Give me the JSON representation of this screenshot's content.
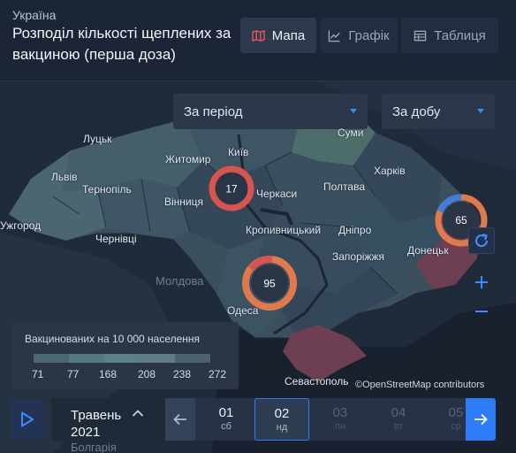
{
  "header": {
    "region": "Україна",
    "title": "Розподіл кількості щеплених за вакциною (перша доза)",
    "tabs": [
      {
        "label": "Мапа",
        "icon": "map-icon",
        "active": true
      },
      {
        "label": "Графік",
        "icon": "line-chart-icon",
        "active": false
      },
      {
        "label": "Таблиця",
        "icon": "table-icon",
        "active": false
      }
    ]
  },
  "filters": {
    "period": "За період",
    "granularity": "За добу"
  },
  "map": {
    "cities": [
      "Луцьк",
      "Житомир",
      "Київ",
      "Суми",
      "Львів",
      "Тернопіль",
      "Вінниця",
      "Черкаси",
      "Полтава",
      "Харків",
      "Ужгород",
      "Чернівці",
      "Кропивницький",
      "Дніпро",
      "Донецьк",
      "Запоріжжя",
      "Одеса",
      "Севастополь"
    ],
    "background_labels": [
      "Молдова",
      "Болгарія"
    ],
    "clusters": [
      {
        "value": "17",
        "city": "Київ"
      },
      {
        "value": "65",
        "city": "Донецьк"
      },
      {
        "value": "95",
        "city": "Одеса"
      }
    ],
    "colors": {
      "accent": "#3d8bff",
      "cluster_red": "#d9534f",
      "cluster_orange": "#e07a4a",
      "occupied": "#6e3f52"
    }
  },
  "legend": {
    "title": "Вакцинованих на 10 000 населення",
    "ticks": [
      "71",
      "77",
      "168",
      "208",
      "238",
      "272"
    ],
    "colors": [
      "#4a6872",
      "#567883",
      "#5c7f8a",
      "#5e7c86",
      "#4a6270",
      "#3f5263"
    ]
  },
  "attribution": "©OpenStreetMap contributors",
  "timeline": {
    "month": "Травень",
    "year": "2021",
    "days": [
      {
        "num": "01",
        "dow": "сб",
        "state": "enabled"
      },
      {
        "num": "02",
        "dow": "нд",
        "state": "active"
      },
      {
        "num": "03",
        "dow": "пн",
        "state": "disabled"
      },
      {
        "num": "04",
        "dow": "вт",
        "state": "disabled"
      },
      {
        "num": "05",
        "dow": "ср",
        "state": "disabled"
      }
    ]
  }
}
